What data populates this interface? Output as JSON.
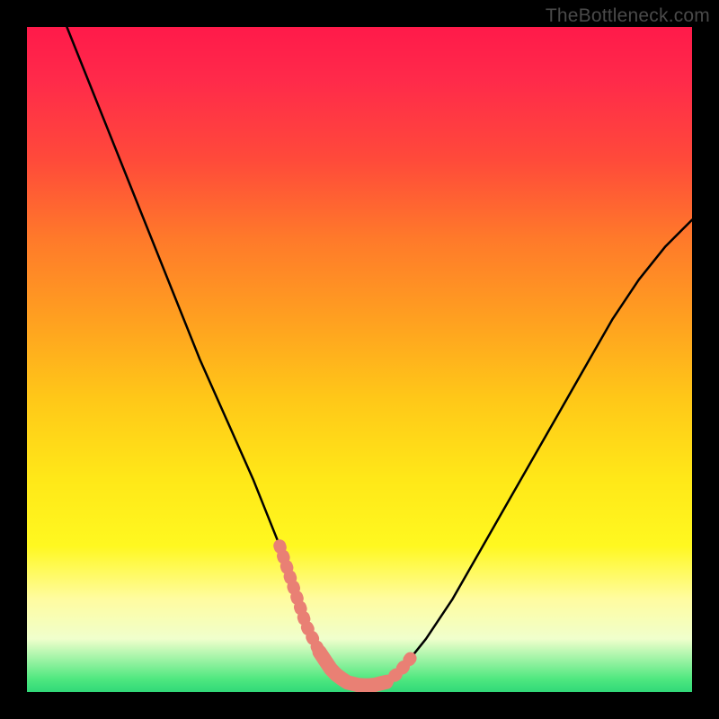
{
  "watermark": "TheBottleneck.com",
  "colors": {
    "curve": "#000000",
    "highlight": "#e98074",
    "background_top": "#ff1a4a",
    "background_bottom": "#30d878",
    "frame": "#000000"
  },
  "chart_data": {
    "type": "line",
    "title": "",
    "xlabel": "",
    "ylabel": "",
    "xlim": [
      0,
      100
    ],
    "ylim": [
      0,
      100
    ],
    "grid": false,
    "legend": false,
    "series": [
      {
        "name": "bottleneck-curve",
        "x": [
          6,
          10,
          14,
          18,
          22,
          26,
          30,
          34,
          38,
          40,
          42,
          44,
          46,
          48,
          50,
          52,
          54,
          56,
          60,
          64,
          68,
          72,
          76,
          80,
          84,
          88,
          92,
          96,
          100
        ],
        "y": [
          100,
          90,
          80,
          70,
          60,
          50,
          41,
          32,
          22,
          16,
          10,
          6,
          3,
          1.5,
          1,
          1,
          1.5,
          3,
          8,
          14,
          21,
          28,
          35,
          42,
          49,
          56,
          62,
          67,
          71
        ]
      }
    ],
    "highlights": [
      {
        "name": "left-dip-marker",
        "x_range": [
          38,
          44
        ],
        "style": "thick-salmon"
      },
      {
        "name": "valley-marker",
        "x_range": [
          44,
          54
        ],
        "style": "thick-salmon"
      },
      {
        "name": "right-dip-marker",
        "x_range": [
          54,
          58
        ],
        "style": "thick-salmon"
      }
    ]
  }
}
